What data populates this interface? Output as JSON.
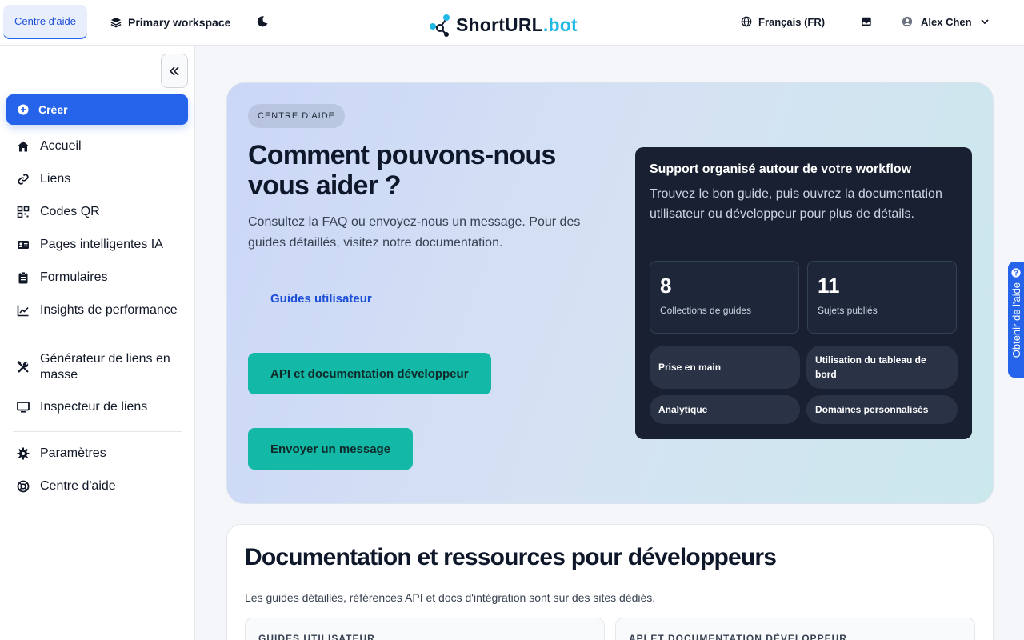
{
  "topbar": {
    "help_tab": "Centre d'aide",
    "workspace": "Primary workspace",
    "logo_main": "ShortURL",
    "logo_accent": ".bot",
    "language": "Français (FR)",
    "user_name": "Alex Chen"
  },
  "sidebar": {
    "create": "Créer",
    "items": [
      {
        "label": "Accueil",
        "icon": "home-icon"
      },
      {
        "label": "Liens",
        "icon": "link-icon"
      },
      {
        "label": "Codes QR",
        "icon": "qr-code-icon"
      },
      {
        "label": "Pages intelligentes IA",
        "icon": "id-card-icon"
      },
      {
        "label": "Formulaires",
        "icon": "clipboard-icon"
      },
      {
        "label": "Insights de performance",
        "icon": "chart-line-icon"
      },
      {
        "label": "Générateur de liens en masse",
        "icon": "tools-icon"
      },
      {
        "label": "Inspecteur de liens",
        "icon": "monitor-icon"
      }
    ],
    "bottom_items": [
      {
        "label": "Paramètres",
        "icon": "gear-icon"
      },
      {
        "label": "Centre d'aide",
        "icon": "lifebuoy-icon"
      }
    ]
  },
  "hero": {
    "pill": "CENTRE D'AIDE",
    "title": "Comment pouvons-nous vous aider ?",
    "subtitle": "Consultez la FAQ ou envoyez-nous un message. Pour des guides détaillés, visitez notre documentation.",
    "guides_link": "Guides utilisateur",
    "api_button": "API et documentation développeur",
    "message_button": "Envoyer un message",
    "card": {
      "title": "Support organisé autour de votre workflow",
      "text": "Trouvez le bon guide, puis ouvrez la documentation utilisateur ou développeur pour plus de détails.",
      "stats": [
        {
          "value": "8",
          "caption": "Collections de guides"
        },
        {
          "value": "11",
          "caption": "Sujets publiés"
        }
      ],
      "chips": [
        "Prise en main",
        "Utilisation du tableau de bord",
        "Analytique",
        "Domaines personnalisés"
      ]
    }
  },
  "docs": {
    "title": "Documentation et ressources pour développeurs",
    "subtitle": "Les guides détaillés, références API et docs d'intégration sont sur des sites dédiés.",
    "cards": [
      "GUIDES UTILISATEUR",
      "API ET DOCUMENTATION DÉVELOPPEUR"
    ]
  },
  "side_help": "Obtenir de l'aide",
  "colors": {
    "primary": "#2563eb",
    "teal": "#14b8a6",
    "dark_card": "#182032",
    "logo_accent": "#22b8e6"
  }
}
